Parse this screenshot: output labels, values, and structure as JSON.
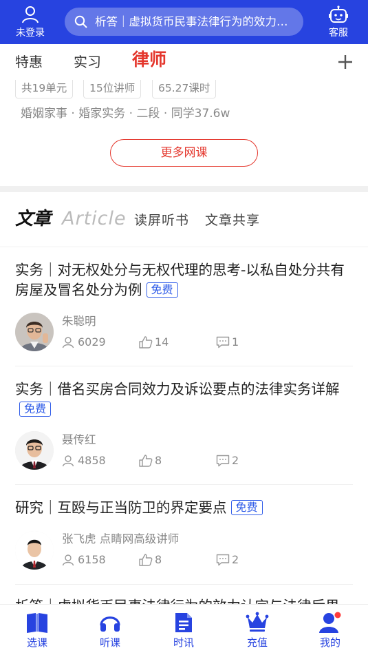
{
  "header": {
    "login_label": "未登录",
    "search_text": "析答｜虚拟货币民事法律行为的效力认定与法律后果",
    "service_label": "客服"
  },
  "tabs": [
    {
      "label": "特惠",
      "active": false
    },
    {
      "label": "实习",
      "active": false
    },
    {
      "label": "律师",
      "active": true
    }
  ],
  "course": {
    "chips": [
      "共19单元",
      "15位讲师",
      "65.27课时"
    ],
    "subtitle": "婚姻家事 · 婚家实务 · 二段 · 同学37.6w",
    "more_button": "更多网课"
  },
  "article_section": {
    "title": "文章",
    "title_en": "Article",
    "tabs": [
      "读屏听书",
      "文章共享"
    ]
  },
  "articles": [
    {
      "title": "实务｜对无权处分与无权代理的思考-以私自处分共有房屋及冒名处分为例",
      "badge": "免费",
      "author": "朱聪明",
      "views": "6029",
      "likes": "14",
      "comments": "1"
    },
    {
      "title": "实务｜借名买房合同效力及诉讼要点的法律实务详解",
      "badge": "免费",
      "author": "聂传红",
      "views": "4858",
      "likes": "8",
      "comments": "2"
    },
    {
      "title": "研究｜互殴与正当防卫的界定要点",
      "badge": "免费",
      "author": "张飞虎  点睛网高级讲师",
      "views": "6158",
      "likes": "8",
      "comments": "2"
    },
    {
      "title": "析答｜虚拟货币民事法律行为的效力认定与法律后果"
    }
  ],
  "bottom_nav": [
    {
      "label": "选课",
      "icon": "book-icon"
    },
    {
      "label": "听课",
      "icon": "headphones-icon"
    },
    {
      "label": "时讯",
      "icon": "document-icon"
    },
    {
      "label": "充值",
      "icon": "crown-icon"
    },
    {
      "label": "我的",
      "icon": "user-icon"
    }
  ],
  "colors": {
    "brand_blue": "#2743e0",
    "accent_red": "#e4362c",
    "badge_blue": "#2e5be8"
  }
}
